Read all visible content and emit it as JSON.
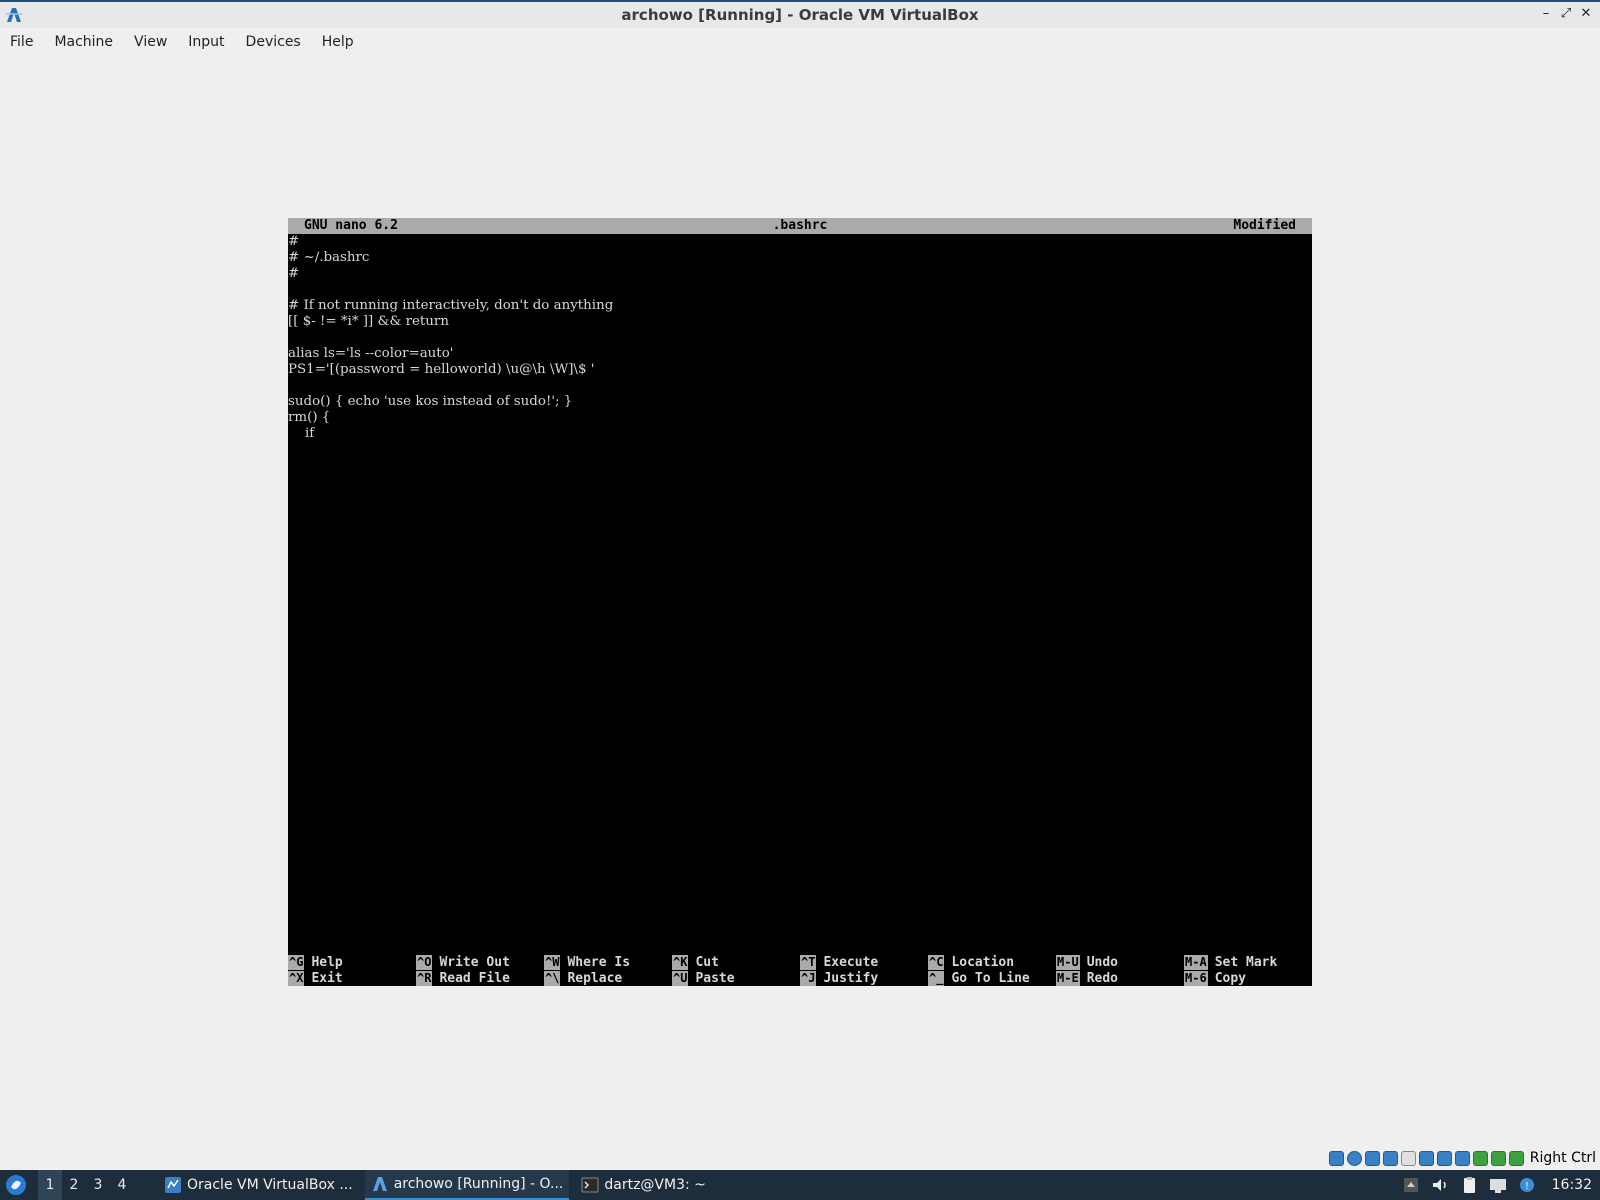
{
  "window": {
    "title": "archowo [Running] - Oracle VM VirtualBox"
  },
  "menu": [
    "File",
    "Machine",
    "View",
    "Input",
    "Devices",
    "Help"
  ],
  "nano": {
    "version": "GNU nano 6.2",
    "filename": ".bashrc",
    "status": "Modified",
    "lines": [
      "#",
      "# ~/.bashrc",
      "#",
      "",
      "# If not running interactively, don't do anything",
      "[[ $- != *i* ]] && return",
      "",
      "alias ls='ls --color=auto'",
      "PS1='[(password = helloworld) \\u@\\h \\W]\\$ '",
      "",
      "sudo() { echo 'use kos instead of sudo!'; }",
      "rm() {",
      "    if"
    ],
    "shortcuts_top": [
      {
        "key": "^G",
        "label": "Help"
      },
      {
        "key": "^O",
        "label": "Write Out"
      },
      {
        "key": "^W",
        "label": "Where Is"
      },
      {
        "key": "^K",
        "label": "Cut"
      },
      {
        "key": "^T",
        "label": "Execute"
      },
      {
        "key": "^C",
        "label": "Location"
      },
      {
        "key": "M-U",
        "label": "Undo"
      },
      {
        "key": "M-A",
        "label": "Set Mark"
      }
    ],
    "shortcuts_bottom": [
      {
        "key": "^X",
        "label": "Exit"
      },
      {
        "key": "^R",
        "label": "Read File"
      },
      {
        "key": "^\\",
        "label": "Replace"
      },
      {
        "key": "^U",
        "label": "Paste"
      },
      {
        "key": "^J",
        "label": "Justify"
      },
      {
        "key": "^_",
        "label": "Go To Line"
      },
      {
        "key": "M-E",
        "label": "Redo"
      },
      {
        "key": "M-6",
        "label": "Copy"
      }
    ]
  },
  "statusbar": {
    "host_key": "Right Ctrl"
  },
  "taskbar": {
    "workspaces": [
      "1",
      "2",
      "3",
      "4"
    ],
    "tasks": [
      {
        "label": "Oracle VM VirtualBox ...",
        "icon": "virtualbox-manager-icon"
      },
      {
        "label": "archowo [Running] - O...",
        "icon": "virtualbox-vm-icon"
      },
      {
        "label": "dartz@VM3: ~",
        "icon": "terminal-icon"
      }
    ],
    "clock": "16:32"
  }
}
